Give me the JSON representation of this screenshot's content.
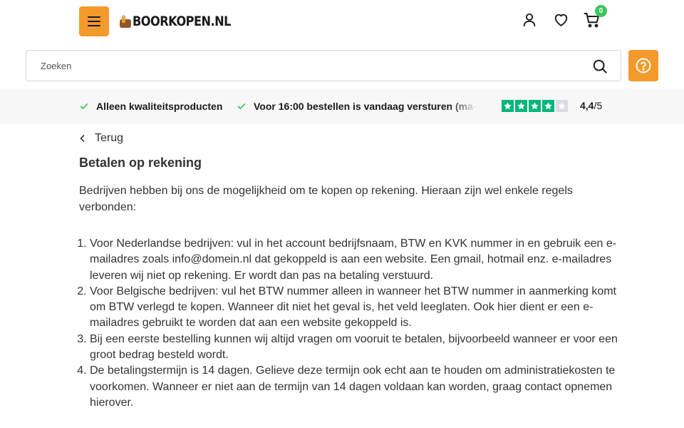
{
  "header": {
    "logo_text": "BOORKOPEN.NL",
    "cart_count": "0",
    "icons": [
      "menu-icon",
      "user-icon",
      "heart-icon",
      "cart-icon"
    ]
  },
  "search": {
    "placeholder": "Zoeken"
  },
  "usps": [
    "Alleen kwaliteitsproducten",
    "Voor 16:00 bestellen is vandaag versturen (ma-"
  ],
  "rating": {
    "score": "4,4",
    "max": "/5",
    "stars_filled": 4,
    "stars_total": 5
  },
  "content": {
    "back_label": "Terug",
    "title": "Betalen op rekening",
    "intro": "Bedrijven hebben bij ons de mogelijkheid om te kopen op rekening. Hieraan zijn wel enkele regels verbonden:",
    "rules": [
      "Voor Nederlandse bedrijven: vul in het account bedrijfsnaam, BTW en KVK nummer in en gebruik een e-mailadres zoals info@domein.nl dat gekoppeld is aan een website. Een gmail, hotmail enz. e-mailadres leveren wij niet op rekening. Er wordt dan pas na betaling verstuurd.",
      "Voor Belgische bedrijven: vul het BTW nummer alleen in wanneer het BTW nummer in aanmerking komt om BTW verlegd te kopen. Wanneer dit niet het geval is, het veld leeglaten. Ook hier dient er een e-mailadres gebruikt te worden dat aan een website gekoppeld is.",
      "Bij een eerste bestelling kunnen wij altijd vragen om vooruit te betalen, bijvoorbeeld wanneer er voor een groot bedrag besteld wordt.",
      "De betalingstermijn is 14 dagen. Gelieve deze termijn ook echt aan te houden om administratiekosten te voorkomen. Wanneer er niet aan de termijn van 14 dagen voldaan kan worden, graag contact opnemen hierover."
    ]
  },
  "colors": {
    "accent": "#f39a2b",
    "badge": "#3cc65a",
    "trust_green": "#00b67a",
    "check_green": "#3cc65a"
  }
}
